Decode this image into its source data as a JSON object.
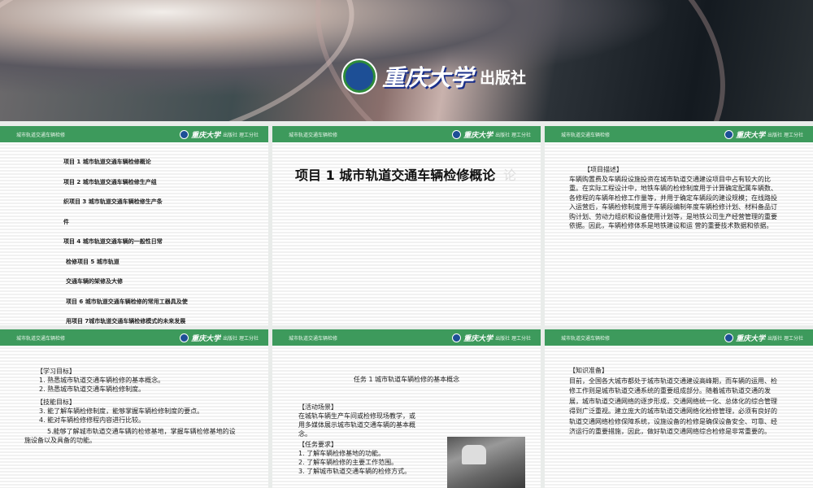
{
  "banner": {
    "publisher_logo_text": "重庆大学",
    "publisher_suffix": "出版社"
  },
  "slide_header": {
    "course": "城市轨道交通车辆检修",
    "brand": "重庆大学",
    "brand_small": "出版社 理工分社"
  },
  "slides": [
    {
      "lines": [
        "项目 1   城市轨道交通车辆检修概论",
        "项目 2   城市轨道交通车辆检修生产组",
        "织项目 3   城市轨道交通车辆检修生产条",
        "件",
        "项目 4       城市轨道交通车辆的一般性日常",
        "检修项目 5                               城市轨道",
        "交通车辆的架修及大修",
        "项目 6    城市轨道交通车辆检修的常用工器具及使",
        "用项目 7城市轨道交通车辆检修模式的未来发展"
      ]
    },
    {
      "title": "项目 1 城市轨道交通车辆检修概论",
      "ghost": "论"
    },
    {
      "heading": "【项目描述】",
      "text": "车辆购置费及车辆段设施投资在城市轨道交通建设项目中占有较大的比重。在实际工程设计中，地铁车辆的检修制度用于计算确定配属车辆数、各修程的车辆年检修工作量等，并用于确定车辆段的建设规模；在线路投入运营后，车辆检修制度用于车辆段编制年度车辆检修计划、材料备品订购计划、劳动力组织和设备使用计划等，是地铁公司生产经营管理的重要依据。因此，车辆检修体系是地铁建设和运 营的重要技术数据和依据。"
    },
    {
      "heading1": "【学习目标】",
      "items1": [
        "1. 熟悉城市轨道交通车辆检修的基本概念。",
        "2. 熟悉城市轨道交通车辆检修制度。"
      ],
      "heading2": "【技能目标】",
      "items2": [
        "3. 能了解车辆检修制度，能够掌握车辆检修制度的要点。",
        "4. 能对车辆检修修程内容进行比较。"
      ],
      "item5": "5.能够了解城市轨道交通车辆的检修基地，掌握车辆检修基地的设施设备以及具备的功能。"
    },
    {
      "task": "任务 1    城市轨道车辆检修的基本概念",
      "heading1": "【活动场景】",
      "scene": "在城轨车辆生产车间或检修现场教学，或用多媒体展示城市轨道交通车辆的基本概念。",
      "heading2": "【任务要求】",
      "items": [
        "1. 了解车辆检修基地的功能。",
        "2. 了解车辆检修的主要工作范围。",
        "3. 了解城市轨道交通车辆的检修方式。"
      ]
    },
    {
      "heading": "【知识准备】",
      "text": "目前，全国各大城市都处于城市轨道交通建设高峰期，而车辆的运用、检修工作则是城市轨道交通系统的重要组成部分。随着城市轨道交通的发展，城市轨道交通网络的逐步形成，交通网络统一化、总体化的综合管理得到广泛重视。建立庞大的城市轨道交通网络化检修管理，必须有良好的轨道交通网络检修保障系统，设施设备的检修是确保设备安全、可靠、经济运行的重要措施，因此，做好轨道交通网络综合检修是非常重要的。"
    }
  ],
  "colors": {
    "header_green": "#3d9a5c"
  }
}
